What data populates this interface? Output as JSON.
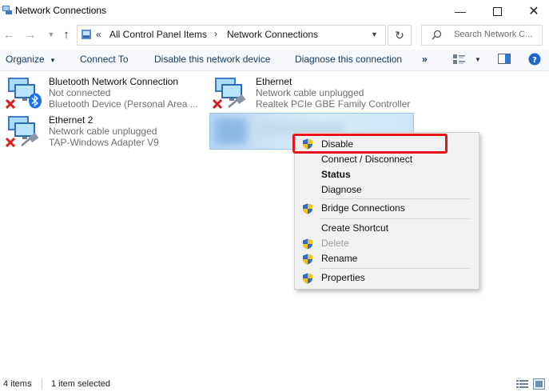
{
  "window": {
    "title": "Network Connections"
  },
  "address": {
    "prefix": "«",
    "crumbs": [
      "All Control Panel Items",
      "Network Connections"
    ],
    "separator": "›"
  },
  "search": {
    "placeholder": "Search Network C..."
  },
  "toolbar": {
    "organize": "Organize",
    "connect_to": "Connect To",
    "disable_device": "Disable this network device",
    "diagnose": "Diagnose this connection",
    "more": "»"
  },
  "connections": [
    {
      "name": "Bluetooth Network Connection",
      "status": "Not connected",
      "device": "Bluetooth Device (Personal Area ..."
    },
    {
      "name": "Ethernet",
      "status": "Network cable unplugged",
      "device": "Realtek PCIe GBE Family Controller"
    },
    {
      "name": "Ethernet 2",
      "status": "Network cable unplugged",
      "device": "TAP-Windows Adapter V9"
    }
  ],
  "context_menu": {
    "disable": "Disable",
    "connect_disconnect": "Connect / Disconnect",
    "status": "Status",
    "diagnose": "Diagnose",
    "bridge": "Bridge Connections",
    "shortcut": "Create Shortcut",
    "delete": "Delete",
    "rename": "Rename",
    "properties": "Properties"
  },
  "statusbar": {
    "count": "4 items",
    "selected": "1 item selected"
  },
  "colors": {
    "highlight_box": "#e8141c",
    "selection": "#cce8ff",
    "accent": "#1e5fb4"
  }
}
